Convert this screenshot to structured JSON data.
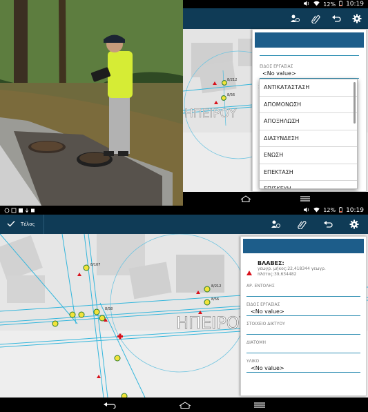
{
  "status_bar": {
    "percent": "12%",
    "time": "10:19"
  },
  "app_bar": {
    "done_label": "Τέλος"
  },
  "map": {
    "street_label": "ΗΠΕΙΡΟΥ",
    "node_labels": [
      "8/212",
      "8/56",
      "8/107",
      "8/58"
    ]
  },
  "form": {
    "section_title": "ΒΛΑΒΕΣ:",
    "coords_text": "γεωγρ. μήκος:22,418344 γεωγρ. πλάτος:39,634482",
    "fields": [
      {
        "label": "ΑΡ. ΕΝΤΟΛΗΣ",
        "value": ""
      },
      {
        "label": "ΕΙΔΟΣ ΕΡΓΑΣΙΑΣ",
        "value": "<No value>"
      },
      {
        "label": "ΣΤΟΙΧΕΙΟ ΔΙΚΤΥΟΥ",
        "value": ""
      },
      {
        "label": "ΔΙΑΤΟΜΗ",
        "value": ""
      },
      {
        "label": "ΥΛΙΚΟ",
        "value": "<No value>"
      }
    ]
  },
  "dropdown": {
    "label": "ΕΙΔΟΣ ΕΡΓΑΣΙΑΣ",
    "current": "<No value>",
    "options": [
      "ΑΝΤΙΚΑΤΑΣΤΑΣΗ",
      "ΑΠΟΜΟΝΩΣΗ",
      "ΑΠΟΞΗΛΩΣΗ",
      "ΔΙΑΣΥΝΔΕΣΗ",
      "ΕΝΩΣΗ",
      "ΕΠΕΚΤΑΣΗ",
      "ΕΠΙΣΚΕΥΗ"
    ]
  },
  "colors": {
    "app_bar": "#0f3b56",
    "panel_header": "#1d5d8a",
    "map_line": "#33b6dc",
    "accent_line": "#2f8fb3"
  }
}
